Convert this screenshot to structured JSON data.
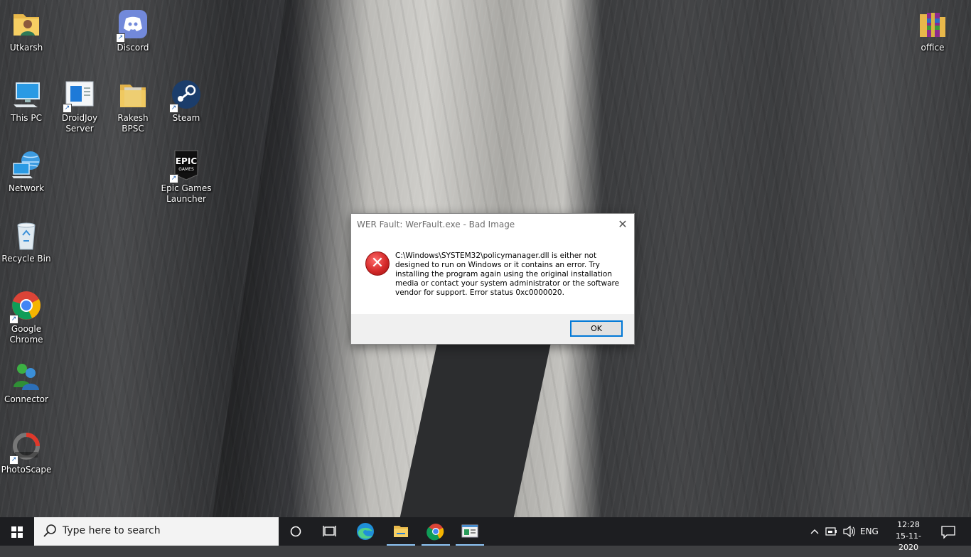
{
  "desktop": {
    "icons": [
      {
        "name": "utkarsh",
        "label": "Utkarsh"
      },
      {
        "name": "discord",
        "label": "Discord"
      },
      {
        "name": "office",
        "label": "office"
      },
      {
        "name": "this-pc",
        "label": "This PC"
      },
      {
        "name": "droidjoy-server",
        "label": "DroidJoy Server"
      },
      {
        "name": "rakesh-bpsc",
        "label": "Rakesh BPSC"
      },
      {
        "name": "steam",
        "label": "Steam"
      },
      {
        "name": "network",
        "label": "Network"
      },
      {
        "name": "epic-games-launcher",
        "label": "Epic Games Launcher"
      },
      {
        "name": "recycle-bin",
        "label": "Recycle Bin"
      },
      {
        "name": "google-chrome",
        "label": "Google Chrome"
      },
      {
        "name": "connector",
        "label": "Connector"
      },
      {
        "name": "photoscape",
        "label": "PhotoScape"
      }
    ]
  },
  "dialog": {
    "title": "WER Fault: WerFault.exe - Bad Image",
    "icon": "error-icon",
    "message": "C:\\Windows\\SYSTEM32\\policymanager.dll is either not designed to run on Windows or it contains an error. Try installing the program again using the original installation media or contact your system administrator or the software vendor for support. Error status 0xc0000020.",
    "ok_label": "OK",
    "close_glyph": "✕"
  },
  "taskbar": {
    "search_placeholder": "Type here to search",
    "language": "ENG",
    "time": "12:28",
    "date": "15-11-2020"
  },
  "colors": {
    "taskbar": "#1d1e21",
    "accent": "#0078d7",
    "error": "#d42a2a"
  }
}
